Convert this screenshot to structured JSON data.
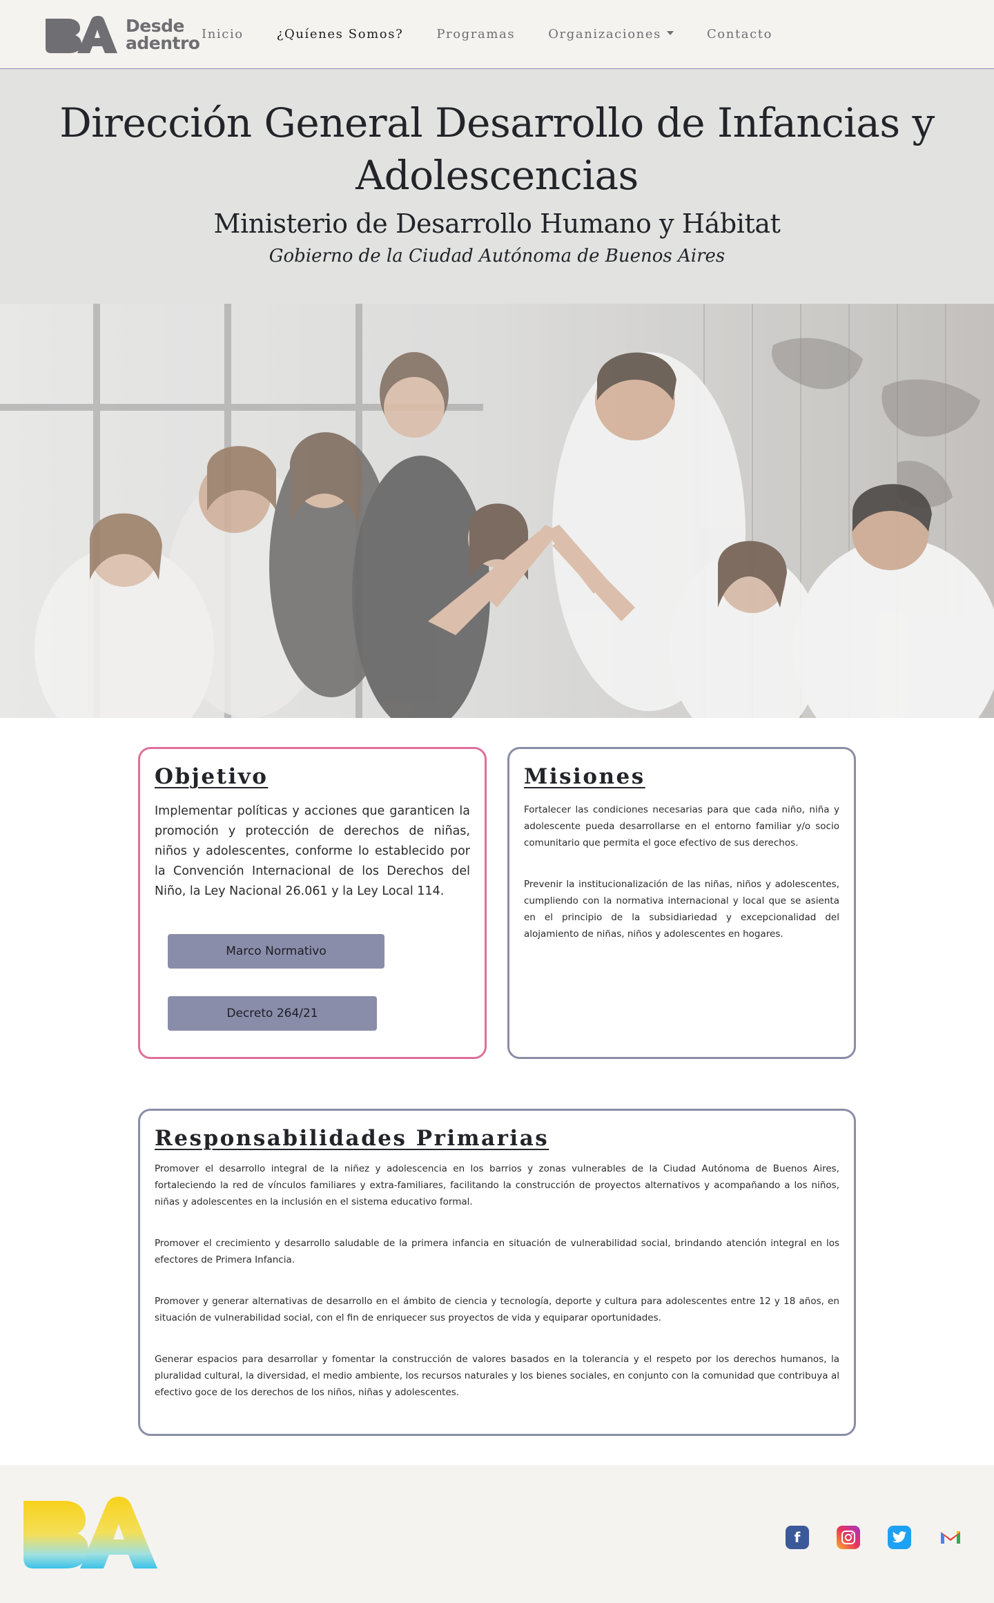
{
  "nav": {
    "brand_line1": "Desde",
    "brand_line2": "adentro",
    "items": [
      {
        "label": "Inicio"
      },
      {
        "label": "¿Quíenes Somos?"
      },
      {
        "label": "Programas"
      },
      {
        "label": "Organizaciones"
      },
      {
        "label": "Contacto"
      }
    ]
  },
  "header": {
    "title": "Dirección General Desarrollo de Infancias y Adolescencias",
    "subtitle": "Ministerio de Desarrollo Humano y Hábitat",
    "tagline": "Gobierno de la Ciudad Autónoma de Buenos Aires"
  },
  "objetivo": {
    "title": "Objetivo",
    "text": "Implementar políticas y acciones que garanticen la promoción y protección de derechos de niñas, niños y adolescentes, conforme lo establecido por la Convención Internacional de los Derechos del Niño, la Ley Nacional 26.061 y la Ley Local 114.",
    "button1": "Marco Normativo",
    "button2": "Decreto 264/21"
  },
  "misiones": {
    "title": "Misiones",
    "items": [
      "Fortalecer las condiciones necesarias para que cada niño, niña y adolescente pueda desarrollarse en el entorno familiar y/o socio comunitario que permita el goce efectivo de sus derechos.",
      "Prevenir la institucionalización de las niñas, niños y adolescentes, cumpliendo con la normativa internacional y local que se asienta en el principio de la subsidiariedad y excepcionalidad del alojamiento de niñas, niños y adolescentes en hogares."
    ]
  },
  "responsabilidades": {
    "title": "Responsabilidades Primarias",
    "items": [
      "Promover el desarrollo integral de la niñez y adolescencia en los barrios y zonas vulnerables de la Ciudad Autónoma de Buenos Aires, fortaleciendo la red de vínculos familiares y extra-familiares, facilitando la construcción de proyectos alternativos y acompañando a los niños, niñas y adolescentes en la inclusión en el sistema educativo formal.",
      "Promover el crecimiento y desarrollo saludable de la primera infancia en situación de vulnerabilidad social, brindando atención integral en los efectores de Primera Infancia.",
      "Promover y generar alternativas de desarrollo en el ámbito de ciencia y tecnología, deporte y cultura para adolescentes entre 12 y 18 años, en situación de vulnerabilidad social, con el fin de enriquecer sus proyectos de vida y equiparar oportunidades.",
      "Generar espacios para desarrollar y fomentar la construcción de valores basados en la tolerancia y el respeto por los derechos humanos, la pluralidad cultural, la diversidad, el medio ambiente, los recursos naturales y los bienes sociales, en conjunto con la comunidad que contribuya al efectivo goce de los derechos de los niños, niñas y adolescentes."
    ]
  },
  "footer": {
    "socials": [
      {
        "icon": "facebook-icon"
      },
      {
        "icon": "instagram-icon"
      },
      {
        "icon": "twitter-icon"
      },
      {
        "icon": "gmail-icon"
      }
    ]
  },
  "colors": {
    "nav_bg": "#f5f3f0",
    "header_bg": "#e2e2e1",
    "card_border": "#8a8da6",
    "objetivo_border": "#de6f9a",
    "button_bg": "#8a8da9"
  }
}
